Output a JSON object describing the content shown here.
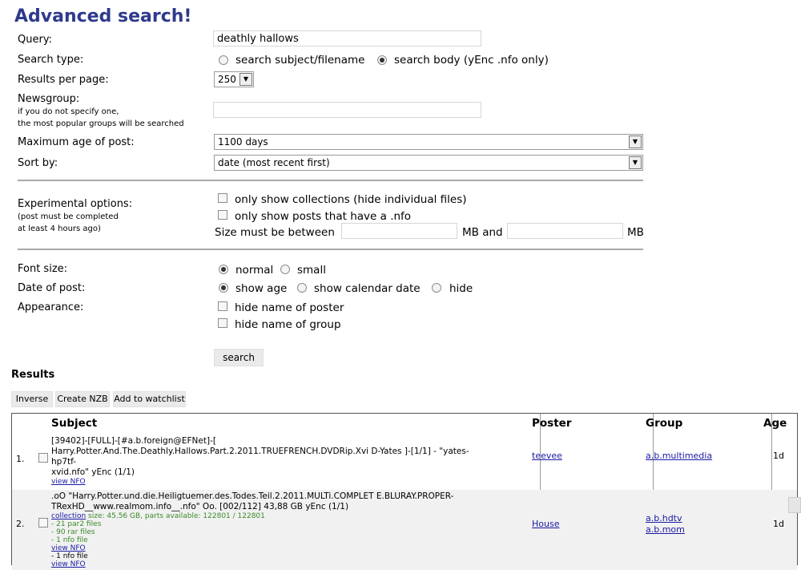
{
  "title": "Advanced search!",
  "form": {
    "query_label": "Query:",
    "query_value": "deathly hallows",
    "search_type_label": "Search type:",
    "search_type_options": [
      "search subject/filename",
      "search body (yEnc .nfo only)"
    ],
    "search_type_selected": "search body (yEnc .nfo only)",
    "results_per_page_label": "Results per page:",
    "results_per_page_value": "250",
    "newsgroup_label": "Newsgroup:",
    "newsgroup_hint_1": "if you do not specify one,",
    "newsgroup_hint_2": "the most popular groups will be searched",
    "newsgroup_value": "",
    "max_age_label": "Maximum age of post:",
    "max_age_value": "1100 days",
    "sort_label": "Sort by:",
    "sort_value": "date (most recent first)",
    "experimental_label": "Experimental options:",
    "experimental_hint_1": "(post must be completed",
    "experimental_hint_2": "at least 4 hours ago)",
    "exp_opt_collections": "only show collections (hide individual files)",
    "exp_opt_nfo": "only show posts that have a .nfo",
    "size_label": "Size must be between",
    "size_mid": "MB and",
    "size_end": "MB",
    "font_size_label": "Font size:",
    "font_size_options": [
      "normal",
      "small"
    ],
    "date_label": "Date of post:",
    "date_options": [
      "show age",
      "show calendar date",
      "hide"
    ],
    "appearance_label": "Appearance:",
    "appearance_options": [
      "hide name of poster",
      "hide name of group"
    ],
    "search_button": "search"
  },
  "results": {
    "heading": "Results",
    "buttons": [
      "Inverse",
      "Create NZB",
      "Add to watchlist"
    ],
    "columns": [
      "Subject",
      "Poster",
      "Group",
      "Age"
    ],
    "rows": [
      {
        "num": "1.",
        "subject_lines": [
          "[39402]-[FULL]-[#a.b.foreign@EFNet]-[",
          "Harry.Potter.And.The.Deathly.Hallows.Part.2.2011.TRUEFRENCH.DVDRip.Xvi D-Yates ]-[1/1] - \"yates-hp7tf-",
          "xvid.nfo\" yEnc (1/1)"
        ],
        "view_nfo": "view NFO",
        "poster": "teevee",
        "groups": [
          "a.b.multimedia"
        ],
        "age": "1d"
      },
      {
        "num": "2.",
        "subject_lines": [
          ".oO \"Harry.Potter.und.die.Heiligtuemer.des.Todes.Teil.2.2011.MULTi.COMPLET E.BLURAY.PROPER-",
          "TRexHD__www.realmom.info__.nfo\" Oo. [002/112] 43,88 GB yEnc (1/1)"
        ],
        "collection_link": "collection",
        "collection_info": " size: 45.56 GB, parts available: 122801 / 122801",
        "details": [
          "- 21 par2 files",
          "- 90 rar files",
          "- 1 nfo file"
        ],
        "view_nfo": "view NFO",
        "extra_lines": [
          "- 1 nfo file",
          "view NFO"
        ],
        "poster": "House",
        "groups": [
          "a.b.hdtv",
          "a.b.mom"
        ],
        "age": "1d"
      }
    ]
  }
}
